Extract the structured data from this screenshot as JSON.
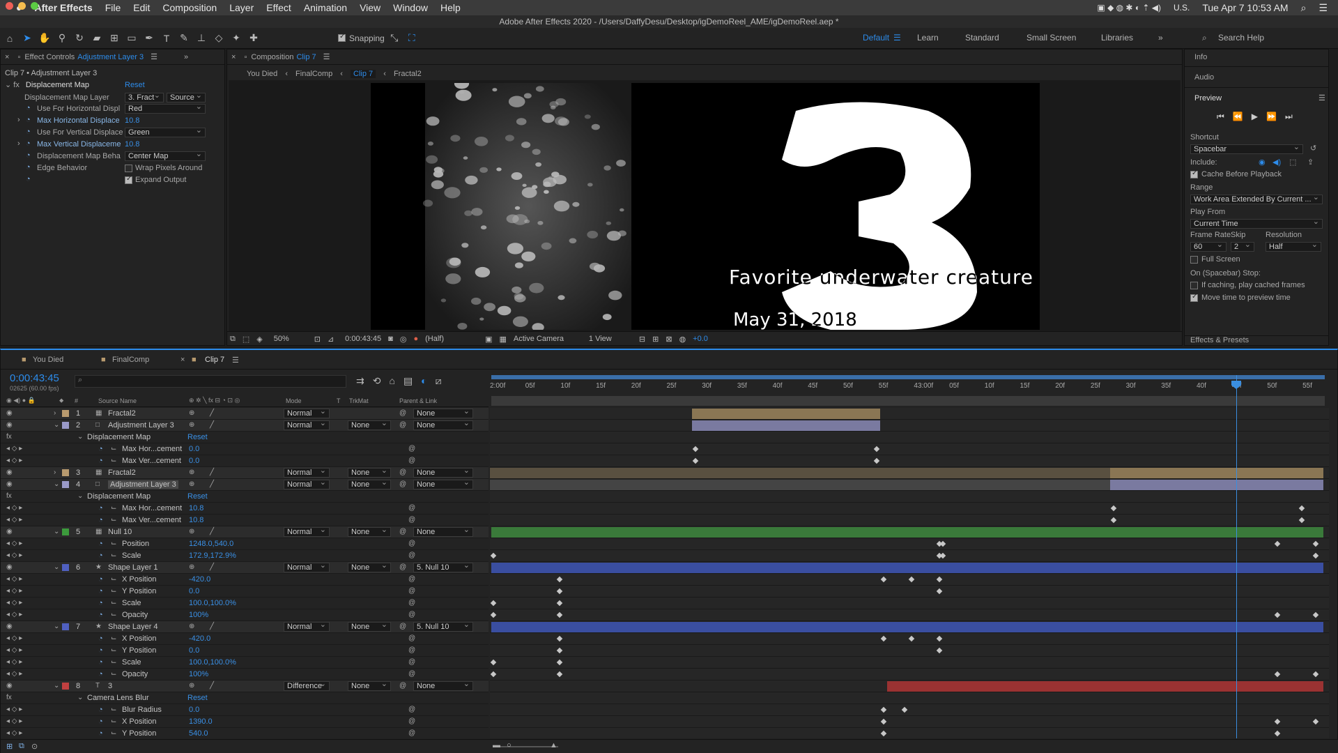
{
  "menubar": {
    "apple": "",
    "app": "After Effects",
    "items": [
      "File",
      "Edit",
      "Composition",
      "Layer",
      "Effect",
      "Animation",
      "View",
      "Window",
      "Help"
    ],
    "locale": "U.S.",
    "datetime": "Tue Apr 7  10:53 AM"
  },
  "title": "Adobe After Effects 2020 - /Users/DaffyDesu/Desktop/igDemoReel_AME/igDemoReel.aep *",
  "toolbar": {
    "snapping": "Snapping",
    "workspaces": [
      "Default",
      "Learn",
      "Standard",
      "Small Screen",
      "Libraries"
    ],
    "search": "Search Help"
  },
  "effect_controls": {
    "tab": "Effect Controls",
    "tab_layer": "Adjustment Layer 3",
    "header": "Clip 7 • Adjustment Layer 3",
    "effect": "Displacement Map",
    "reset": "Reset",
    "params": [
      {
        "label": "Displacement Map Layer",
        "v1": "3. Fract",
        "v2": "Source"
      },
      {
        "label": "Use For Horizontal Displ",
        "v1": "Red"
      },
      {
        "label": "Max Horizontal Displace",
        "v1": "10.8"
      },
      {
        "label": "Use For Vertical Displace",
        "v1": "Green"
      },
      {
        "label": "Max Vertical Displaceme",
        "v1": "10.8"
      },
      {
        "label": "Displacement Map Beha",
        "v1": "Center Map"
      },
      {
        "label": "Edge Behavior",
        "v1": "Wrap Pixels Around"
      },
      {
        "label": "",
        "v1": "Expand Output"
      }
    ]
  },
  "composition": {
    "tab": "Composition",
    "tab_name": "Clip 7",
    "crumbs": [
      "You Died",
      "FinalComp",
      "Clip 7",
      "Fractal2"
    ],
    "frame_number": "3",
    "caption": "Favorite underwater creature",
    "date": "May 31, 2018",
    "zoom": "50%",
    "time": "0:00:43:45",
    "resolution": "(Half)",
    "camera": "Active Camera",
    "views": "1 View",
    "exposure": "+0.0"
  },
  "right_panel": {
    "info": "Info",
    "audio": "Audio",
    "preview": "Preview",
    "shortcut_label": "Shortcut",
    "shortcut": "Spacebar",
    "include": "Include:",
    "cache": "Cache Before Playback",
    "range_label": "Range",
    "range": "Work Area Extended By Current ...",
    "playfrom_label": "Play From",
    "playfrom": "Current Time",
    "fr_label": "Frame Rate",
    "skip_label": "Skip",
    "res_label": "Resolution",
    "fr": "60",
    "skip": "2",
    "res": "Half",
    "fullscreen": "Full Screen",
    "stop_label": "On (Spacebar) Stop:",
    "stop1": "If caching, play cached frames",
    "stop2": "Move time to preview time",
    "effects": "Effects & Presets"
  },
  "timeline": {
    "tabs": [
      "You Died",
      "FinalComp",
      "Clip 7"
    ],
    "timecode": "0:00:43:45",
    "frames": "02625 (60.00 fps)",
    "cols": {
      "hash": "#",
      "source": "Source Name",
      "mode": "Mode",
      "t": "T",
      "trkmat": "TrkMat",
      "parent": "Parent & Link"
    },
    "ticks": [
      "2:00f",
      "05f",
      "10f",
      "15f",
      "20f",
      "25f",
      "30f",
      "35f",
      "40f",
      "45f",
      "50f",
      "55f",
      "43:00f",
      "05f",
      "10f",
      "15f",
      "20f",
      "25f",
      "30f",
      "35f",
      "40f",
      "45f",
      "50f",
      "55f"
    ],
    "rows": [
      {
        "num": "1",
        "name": "Fractal2",
        "mode": "Normal",
        "trk": "",
        "parent": "None",
        "type": "layer",
        "color": "#b89a6e"
      },
      {
        "num": "2",
        "name": "Adjustment Layer 3",
        "mode": "Normal",
        "trk": "None",
        "parent": "None",
        "type": "layer",
        "color": "#9a9ac8"
      },
      {
        "name": "Displacement Map",
        "reset": "Reset",
        "type": "group"
      },
      {
        "name": "Max Hor...cement",
        "value": "0.0",
        "type": "prop"
      },
      {
        "name": "Max Ver...cement",
        "value": "0.0",
        "type": "prop"
      },
      {
        "num": "3",
        "name": "Fractal2",
        "mode": "Normal",
        "trk": "None",
        "parent": "None",
        "type": "layer",
        "color": "#b89a6e"
      },
      {
        "num": "4",
        "name": "Adjustment Layer 3",
        "mode": "Normal",
        "trk": "None",
        "parent": "None",
        "type": "layer",
        "color": "#9a9ac8"
      },
      {
        "name": "Displacement Map",
        "reset": "Reset",
        "type": "group"
      },
      {
        "name": "Max Hor...cement",
        "value": "10.8",
        "type": "prop"
      },
      {
        "name": "Max Ver...cement",
        "value": "10.8",
        "type": "prop"
      },
      {
        "num": "5",
        "name": "Null 10",
        "mode": "Normal",
        "trk": "None",
        "parent": "None",
        "type": "layer",
        "color": "#3c9a3c"
      },
      {
        "name": "Position",
        "value": "1248.0,540.0",
        "type": "prop"
      },
      {
        "name": "Scale",
        "value": "172.9,172.9%",
        "type": "prop"
      },
      {
        "num": "6",
        "name": "Shape Layer 1",
        "mode": "Normal",
        "trk": "None",
        "parent": "5. Null 10",
        "type": "layer",
        "color": "#5060c0"
      },
      {
        "name": "X Position",
        "value": "-420.0",
        "type": "prop"
      },
      {
        "name": "Y Position",
        "value": "0.0",
        "type": "prop"
      },
      {
        "name": "Scale",
        "value": "100.0,100.0%",
        "type": "prop"
      },
      {
        "name": "Opacity",
        "value": "100%",
        "type": "prop"
      },
      {
        "num": "7",
        "name": "Shape Layer 4",
        "mode": "Normal",
        "trk": "None",
        "parent": "5. Null 10",
        "type": "layer",
        "color": "#5060c0"
      },
      {
        "name": "X Position",
        "value": "-420.0",
        "type": "prop"
      },
      {
        "name": "Y Position",
        "value": "0.0",
        "type": "prop"
      },
      {
        "name": "Scale",
        "value": "100.0,100.0%",
        "type": "prop"
      },
      {
        "name": "Opacity",
        "value": "100%",
        "type": "prop"
      },
      {
        "num": "8",
        "name": "3",
        "mode": "Difference",
        "trk": "None",
        "parent": "None",
        "type": "layer",
        "color": "#c04040"
      },
      {
        "name": "Camera Lens Blur",
        "reset": "Reset",
        "type": "group"
      },
      {
        "name": "Blur Radius",
        "value": "0.0",
        "type": "prop"
      },
      {
        "name": "X Position",
        "value": "1390.0",
        "type": "prop"
      },
      {
        "name": "Y Position",
        "value": "540.0",
        "type": "prop"
      }
    ]
  }
}
